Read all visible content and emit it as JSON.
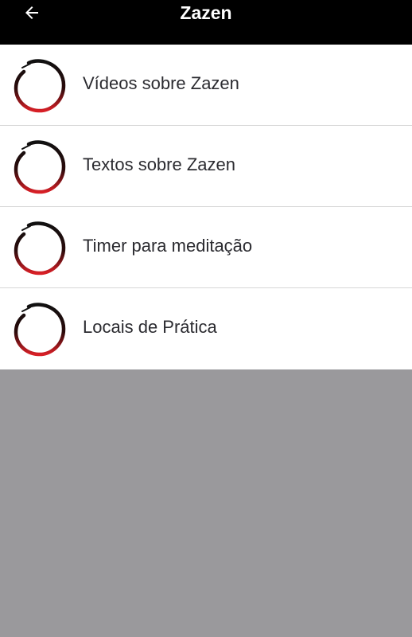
{
  "header": {
    "title": "Zazen",
    "back_icon": "arrow-left-icon"
  },
  "menu": {
    "items": [
      {
        "label": "Vídeos sobre Zazen",
        "icon": "enso-circle-icon"
      },
      {
        "label": "Textos sobre Zazen",
        "icon": "enso-circle-icon"
      },
      {
        "label": "Timer para meditação",
        "icon": "enso-circle-icon"
      },
      {
        "label": "Locais de Prática",
        "icon": "enso-circle-icon"
      }
    ]
  },
  "colors": {
    "header_bg": "#000000",
    "list_bg": "#ffffff",
    "backdrop": "#9a999c",
    "text": "#2b2b30",
    "enso_dark": "#111111",
    "enso_red": "#d81f26"
  }
}
